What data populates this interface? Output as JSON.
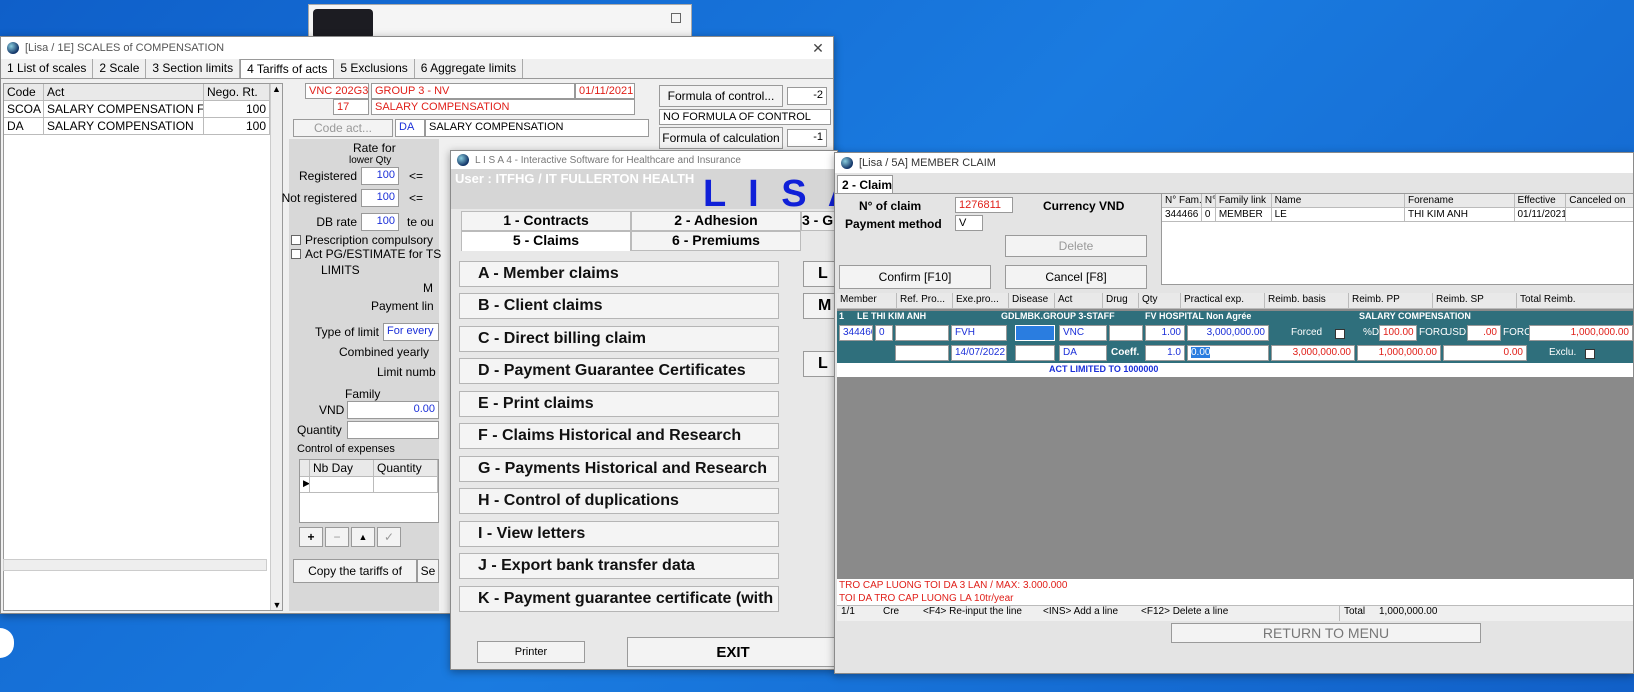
{
  "scales_window": {
    "title": "[Lisa / 1E] SCALES of COMPENSATION",
    "tabs": [
      "1 List of scales",
      "2 Scale",
      "3 Section limits",
      "4 Tariffs of acts",
      "5 Exclusions",
      "6 Aggregate limits"
    ],
    "grid_headers": [
      "Code",
      "Act",
      "Nego. Rt."
    ],
    "rows": [
      {
        "code": "SCOA",
        "act": "SALARY COMPENSATION FO",
        "rate": "100"
      },
      {
        "code": "DA",
        "act": "SALARY COMPENSATION",
        "rate": "100"
      }
    ],
    "contract_code": "VNC",
    "group_code": "202G3",
    "group_name": "GROUP 3 - NV",
    "date": "01/11/2021",
    "line_no": "17",
    "line_name": "SALARY COMPENSATION",
    "code_act_button": "Code act...",
    "act_code": "DA",
    "act_name": "SALARY COMPENSATION",
    "formula_control_button": "Formula of control...",
    "formula_control_value": "-2",
    "no_formula_control": "NO FORMULA OF CONTROL",
    "formula_calc_button": "Formula of calculation",
    "formula_calc_value": "-1",
    "rate_for": "Rate for",
    "lower_qty": "lower Qty",
    "registered_label": "Registered",
    "registered_value": "100",
    "not_registered_label": "Not registered",
    "not_registered_value": "100",
    "db_rate_label": "DB rate",
    "db_rate_value": "100",
    "db_rate_suffix": "te ou",
    "le_sign": "<=",
    "prescription_label": "Prescription compulsory",
    "act_pg_label": "Act PG/ESTIMATE for TS",
    "limits_label": "LIMITS",
    "m_label": "M",
    "payment_limit_label": "Payment lin",
    "type_of_limit_label": "Type of limit",
    "type_of_limit_value": "For every",
    "combined_yearly_label": "Combined yearly",
    "limit_number_label": "Limit numb",
    "family_label": "Family",
    "vnd_label": "VND",
    "vnd_value": "0.00",
    "quantity_label": "Quantity",
    "control_expenses_label": "Control of expenses",
    "nb_day_header": "Nb Day",
    "quantity_header": "Quantity",
    "copy_tariffs_button": "Copy the tariffs of",
    "se_button": "Se"
  },
  "lisa_menu": {
    "title": "L I S A 4 - Interactive Software for Healthcare and Insurance",
    "user": "User : ITFHG / IT FULLERTON HEALTH",
    "logo": "L I S A",
    "top_tabs": [
      "1 - Contracts",
      "2 - Adhesion",
      "3 - G",
      "5 - Claims",
      "6 - Premiums"
    ],
    "items": [
      "A - Member claims",
      "B - Client claims",
      "C - Direct billing claim",
      "D - Payment Guarantee Certificates",
      "E - Print claims",
      "F - Claims Historical and Research",
      "G - Payments Historical and Research",
      "H - Control of duplications",
      "I - View letters",
      "J - Export bank transfer data",
      "K - Payment guarantee certificate (with a"
    ],
    "right_letters": [
      "L",
      "M",
      "L"
    ],
    "printer_button": "Printer",
    "exit_button": "EXIT"
  },
  "member_claim": {
    "title": "[Lisa / 5A] MEMBER CLAIM",
    "tab": "2 - Claim",
    "claim_no_label": "N° of claim",
    "claim_no_value": "1276811",
    "currency_label": "Currency VND",
    "payment_method_label": "Payment method",
    "payment_method_value": "V",
    "delete_button": "Delete",
    "confirm_button": "Confirm [F10]",
    "cancel_button": "Cancel [F8]",
    "family_headers": [
      "N° Fam.",
      "N°",
      "Family link",
      "Name",
      "Forename",
      "Effective",
      "Canceled on"
    ],
    "family_row": [
      "344466",
      "0",
      "MEMBER",
      "LE",
      "THI KIM ANH",
      "01/11/2021",
      ""
    ],
    "line_headers": [
      "Member",
      "Ref. Pro...",
      "Exe.pro...",
      "Disease",
      "Act",
      "Drug",
      "Qty",
      "Practical exp.",
      "Reimb. basis",
      "Reimb. PP",
      "Reimb. SP",
      "Total Reimb."
    ],
    "teal_row": {
      "no": "1",
      "member_name": "LE THI KIM ANH",
      "group": "GDLMBK.GROUP 3-STAFF",
      "provider": "FV HOSPITAL Non Agrée",
      "act_desc": "SALARY COMPENSATION"
    },
    "line1": {
      "member": "344466",
      "ref": "0",
      "exe": "FVH",
      "act": "VNC",
      "qty": "1.00",
      "practical": "3,000,000.00",
      "forced": "Forced",
      "pct_label": "%D",
      "pct": "100.00",
      "forc": "FORC",
      "usd_label": "USD",
      "sp_value": ".00",
      "forc2": "FORC",
      "total": "1,000,000.00"
    },
    "line2": {
      "date": "14/07/2022",
      "act": "DA",
      "coeff_label": "Coeff.",
      "coeff": "1.0",
      "qty2": "0.00",
      "basis": "3,000,000.00",
      "pp": "1,000,000.00",
      "sp": "0.00",
      "exclu": "Exclu."
    },
    "act_limited": "ACT LIMITED TO 1000000",
    "note1": "TRO CAP LUONG TOI DA 3 LAN / MAX: 3.000.000",
    "note2": "TOI DA TRO CAP LUONG LA 10tr/year",
    "status": {
      "page": "1/1",
      "mode": "Cre",
      "f4": "<F4> Re-input the line",
      "ins": "<INS> Add a line",
      "f12": "<F12> Delete a line",
      "total_label": "Total",
      "total_value": "1,000,000.00"
    },
    "return_button": "RETURN TO MENU"
  }
}
